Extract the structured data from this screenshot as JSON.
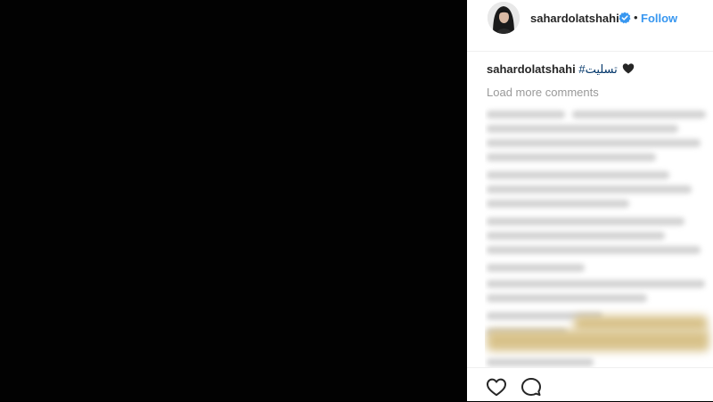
{
  "post": {
    "username": "sahardolatshahi",
    "follow_label": "Follow",
    "separator": "•",
    "verified": true,
    "icons": {
      "avatar": "profile-photo",
      "verified": "verified-badge-icon",
      "like": "heart-outline-icon",
      "comment": "speech-bubble-icon",
      "caption_emoji": "black-heart-emoji"
    }
  },
  "caption": {
    "username": "sahardolatshahi",
    "text": "#تسلیت"
  },
  "comments": {
    "load_more_label": "Load more comments"
  },
  "colors": {
    "link_blue": "#3897f0",
    "text_dark": "#262626",
    "muted": "#999999",
    "media_bg": "#020202"
  }
}
